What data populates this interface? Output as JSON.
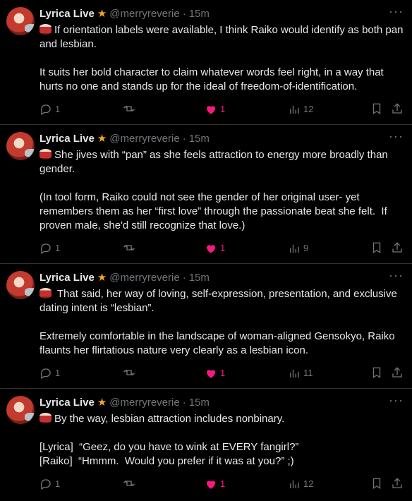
{
  "tweets": [
    {
      "author": "Lyrica Live",
      "handle": "@merryreverie",
      "time": "15m",
      "body": "If orientation labels were available, I think Raiko would identify as both pan and lesbian.\n\nIt suits her bold character to claim whatever words feel right, in a way that hurts no one and stands up for the ideal of freedom-of-identification.",
      "replies": "1",
      "likes": "1",
      "views": "12"
    },
    {
      "author": "Lyrica Live",
      "handle": "@merryreverie",
      "time": "15m",
      "body": "She jives with “pan” as she feels attraction to energy more broadly than gender.\n\n(In tool form, Raiko could not see the gender of her original user- yet remembers them as her “first love” through the passionate beat she felt.  If proven male, she'd still recognize that love.)",
      "replies": "1",
      "likes": "1",
      "views": "9"
    },
    {
      "author": "Lyrica Live",
      "handle": "@merryreverie",
      "time": "15m",
      "body": " That said, her way of loving, self-expression, presentation, and exclusive dating intent is “lesbian”.\n\nExtremely comfortable in the landscape of woman-aligned Gensokyo, Raiko flaunts her flirtatious nature very clearly as a lesbian icon.",
      "replies": "1",
      "likes": "1",
      "views": "11"
    },
    {
      "author": "Lyrica Live",
      "handle": "@merryreverie",
      "time": "15m",
      "body": "By the way, lesbian attraction includes nonbinary.\n\n[Lyrica]  “Geez, do you have to wink at EVERY fangirl?”\n[Raiko]  “Hmmm.  Would you prefer if it was at you?” ;)",
      "replies": "1",
      "likes": "1",
      "views": "12"
    }
  ],
  "labels": {
    "separator_dot": "·",
    "more": "···"
  },
  "colors": {
    "like": "#f91880",
    "muted": "#71767b",
    "star": "#f5a623"
  }
}
